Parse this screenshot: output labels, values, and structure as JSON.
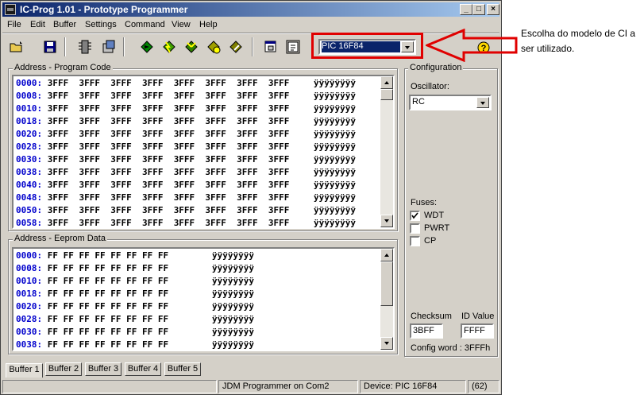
{
  "window": {
    "title": "IC-Prog 1.01 - Prototype Programmer",
    "caption_buttons": {
      "minimize": "_",
      "maximize": "□",
      "close": "×"
    }
  },
  "menu": [
    "File",
    "Edit",
    "Buffer",
    "Settings",
    "Command",
    "View",
    "Help"
  ],
  "toolbar": {
    "device": "PIC 16F84",
    "icons": [
      "open-icon",
      "save-icon",
      "read-icon",
      "configuration-icon",
      "program-icon",
      "program-all-icon",
      "verify-icon",
      "erase-icon",
      "blank-check-icon",
      "window-icon",
      "hex-view-icon",
      "help-icon"
    ]
  },
  "program_code": {
    "label": "Address - Program Code",
    "rows": [
      {
        "addr": "0000:",
        "data": "3FFF  3FFF  3FFF  3FFF  3FFF  3FFF  3FFF  3FFF",
        "ascii": "ÿÿÿÿÿÿÿÿ"
      },
      {
        "addr": "0008:",
        "data": "3FFF  3FFF  3FFF  3FFF  3FFF  3FFF  3FFF  3FFF",
        "ascii": "ÿÿÿÿÿÿÿÿ"
      },
      {
        "addr": "0010:",
        "data": "3FFF  3FFF  3FFF  3FFF  3FFF  3FFF  3FFF  3FFF",
        "ascii": "ÿÿÿÿÿÿÿÿ"
      },
      {
        "addr": "0018:",
        "data": "3FFF  3FFF  3FFF  3FFF  3FFF  3FFF  3FFF  3FFF",
        "ascii": "ÿÿÿÿÿÿÿÿ"
      },
      {
        "addr": "0020:",
        "data": "3FFF  3FFF  3FFF  3FFF  3FFF  3FFF  3FFF  3FFF",
        "ascii": "ÿÿÿÿÿÿÿÿ"
      },
      {
        "addr": "0028:",
        "data": "3FFF  3FFF  3FFF  3FFF  3FFF  3FFF  3FFF  3FFF",
        "ascii": "ÿÿÿÿÿÿÿÿ"
      },
      {
        "addr": "0030:",
        "data": "3FFF  3FFF  3FFF  3FFF  3FFF  3FFF  3FFF  3FFF",
        "ascii": "ÿÿÿÿÿÿÿÿ"
      },
      {
        "addr": "0038:",
        "data": "3FFF  3FFF  3FFF  3FFF  3FFF  3FFF  3FFF  3FFF",
        "ascii": "ÿÿÿÿÿÿÿÿ"
      },
      {
        "addr": "0040:",
        "data": "3FFF  3FFF  3FFF  3FFF  3FFF  3FFF  3FFF  3FFF",
        "ascii": "ÿÿÿÿÿÿÿÿ"
      },
      {
        "addr": "0048:",
        "data": "3FFF  3FFF  3FFF  3FFF  3FFF  3FFF  3FFF  3FFF",
        "ascii": "ÿÿÿÿÿÿÿÿ"
      },
      {
        "addr": "0050:",
        "data": "3FFF  3FFF  3FFF  3FFF  3FFF  3FFF  3FFF  3FFF",
        "ascii": "ÿÿÿÿÿÿÿÿ"
      },
      {
        "addr": "0058:",
        "data": "3FFF  3FFF  3FFF  3FFF  3FFF  3FFF  3FFF  3FFF",
        "ascii": "ÿÿÿÿÿÿÿÿ"
      }
    ]
  },
  "eeprom_data": {
    "label": "Address - Eeprom Data",
    "rows": [
      {
        "addr": "0000:",
        "data": "FF FF FF FF FF FF FF FF",
        "ascii": "ÿÿÿÿÿÿÿÿ"
      },
      {
        "addr": "0008:",
        "data": "FF FF FF FF FF FF FF FF",
        "ascii": "ÿÿÿÿÿÿÿÿ"
      },
      {
        "addr": "0010:",
        "data": "FF FF FF FF FF FF FF FF",
        "ascii": "ÿÿÿÿÿÿÿÿ"
      },
      {
        "addr": "0018:",
        "data": "FF FF FF FF FF FF FF FF",
        "ascii": "ÿÿÿÿÿÿÿÿ"
      },
      {
        "addr": "0020:",
        "data": "FF FF FF FF FF FF FF FF",
        "ascii": "ÿÿÿÿÿÿÿÿ"
      },
      {
        "addr": "0028:",
        "data": "FF FF FF FF FF FF FF FF",
        "ascii": "ÿÿÿÿÿÿÿÿ"
      },
      {
        "addr": "0030:",
        "data": "FF FF FF FF FF FF FF FF",
        "ascii": "ÿÿÿÿÿÿÿÿ"
      },
      {
        "addr": "0038:",
        "data": "FF FF FF FF FF FF FF FF",
        "ascii": "ÿÿÿÿÿÿÿÿ"
      }
    ]
  },
  "configuration": {
    "label": "Configuration",
    "oscillator_label": "Oscillator:",
    "oscillator_value": "RC",
    "fuses_label": "Fuses:",
    "fuses": [
      {
        "name": "WDT",
        "checked": true
      },
      {
        "name": "PWRT",
        "checked": false
      },
      {
        "name": "CP",
        "checked": false
      }
    ],
    "checksum_label": "Checksum",
    "checksum_value": "3BFF",
    "id_label": "ID Value",
    "id_value": "FFFF",
    "config_word": "Config word : 3FFFh"
  },
  "buffers": [
    "Buffer 1",
    "Buffer 2",
    "Buffer 3",
    "Buffer 4",
    "Buffer 5"
  ],
  "status": {
    "programmer": "JDM Programmer on Com2",
    "device": "Device: PIC 16F84",
    "count": "(62)"
  },
  "annotation": {
    "text": "Escolha do modelo de CI a ser utilizado.",
    "highlight_color": "#e00000"
  }
}
